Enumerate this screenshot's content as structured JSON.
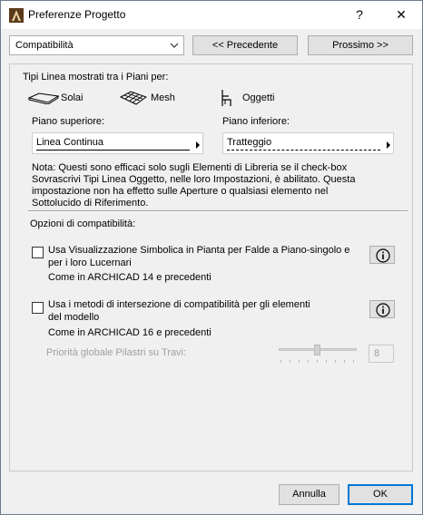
{
  "window": {
    "title": "Preferenze Progetto",
    "help_label": "?",
    "close_label": "✕"
  },
  "toolbar": {
    "dropdown_value": "Compatibilità",
    "prev_label": "<< Precedente",
    "next_label": "Prossimo >>"
  },
  "line_types": {
    "heading": "Tipi Linea mostrati tra i Piani per:",
    "items": [
      {
        "label": "Solai",
        "icon": "slab-icon"
      },
      {
        "label": "Mesh",
        "icon": "mesh-icon"
      },
      {
        "label": "Oggetti",
        "icon": "chair-icon"
      }
    ],
    "upper_label": "Piano superiore:",
    "upper_value": "Linea Continua",
    "lower_label": "Piano inferiore:",
    "lower_value": "Tratteggio",
    "note_lines": [
      "Nota: Questi sono efficaci solo sugli Elementi di Libreria se il check-box",
      "Sovrascrivi Tipi Linea Oggetto, nelle loro Impostazioni, è abilitato. Questa",
      "impostazione non ha effetto sulle Aperture o qualsiasi elemento nel",
      "Sottolucido di Riferimento."
    ]
  },
  "compat": {
    "heading": "Opzioni di compatibilità:",
    "option1_lines": [
      "Usa Visualizzazione Simbolica in Pianta per Falde a Piano-singolo e",
      "per i loro Lucernari"
    ],
    "option1_checked": false,
    "option1_note": "Come in ARCHICAD 14 e precedenti",
    "option2_lines": [
      "Usa i metodi di intersezione di compatibilità per gli elementi",
      "del modello"
    ],
    "option2_checked": false,
    "option2_note": "Come in ARCHICAD 16 e precedenti",
    "priority_label": "Priorità globale Pilastri su Travi:",
    "priority_value": "8"
  },
  "footer": {
    "cancel_label": "Annulla",
    "ok_label": "OK"
  }
}
